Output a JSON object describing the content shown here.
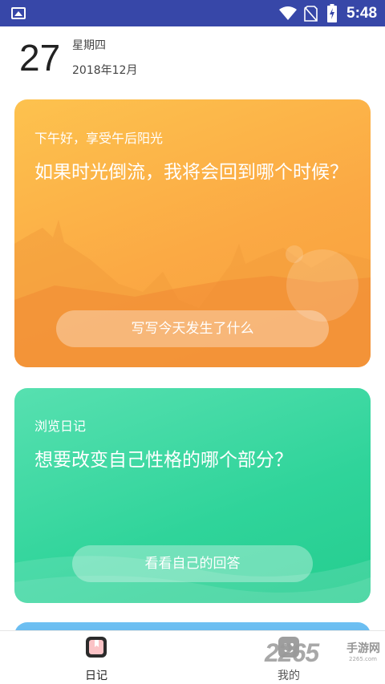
{
  "status_bar": {
    "time": "5:48",
    "icons": [
      "gallery-icon",
      "wifi-icon",
      "no-sim-icon",
      "battery-charging-icon"
    ]
  },
  "header": {
    "day": "27",
    "weekday": "星期四",
    "year_month": "2018年12月"
  },
  "cards": [
    {
      "subtitle": "下午好，享受午后阳光",
      "question": "如果时光倒流，我将会回到哪个时候？",
      "button_label": "写写今天发生了什么",
      "color": "#fba944"
    },
    {
      "subtitle": "浏览日记",
      "question": "想要改变自己性格的哪个部分？",
      "button_label": "看看自己的回答",
      "color": "#2fd49a"
    },
    {
      "color": "#5db2ec"
    }
  ],
  "bottom_nav": {
    "items": [
      {
        "label": "日记",
        "icon": "diary-icon",
        "active": true
      },
      {
        "label": "我的",
        "icon": "profile-icon",
        "active": false
      }
    ]
  },
  "watermark": {
    "number": "2265",
    "site": "手游网",
    "domain": "2265.com"
  }
}
